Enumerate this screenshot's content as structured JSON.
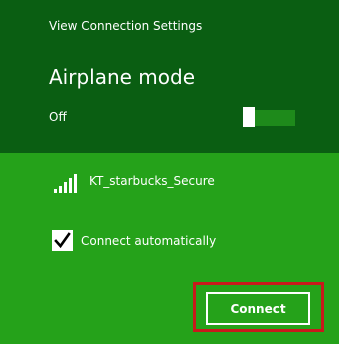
{
  "header": {
    "settings_link": "View Connection Settings"
  },
  "airplane": {
    "title": "Airplane mode",
    "state": "Off",
    "enabled": false
  },
  "network": {
    "name": "KT_starbucks_Secure",
    "signal_bars": 5,
    "icon": "wifi-signal-icon"
  },
  "auto_connect": {
    "label": "Connect automatically",
    "checked": true,
    "icon": "checkmark-icon"
  },
  "actions": {
    "connect_label": "Connect"
  },
  "colors": {
    "top_panel": "#0a5e12",
    "bottom_panel": "#25a21a",
    "highlight": "#c8191c",
    "text": "#ffffff"
  }
}
